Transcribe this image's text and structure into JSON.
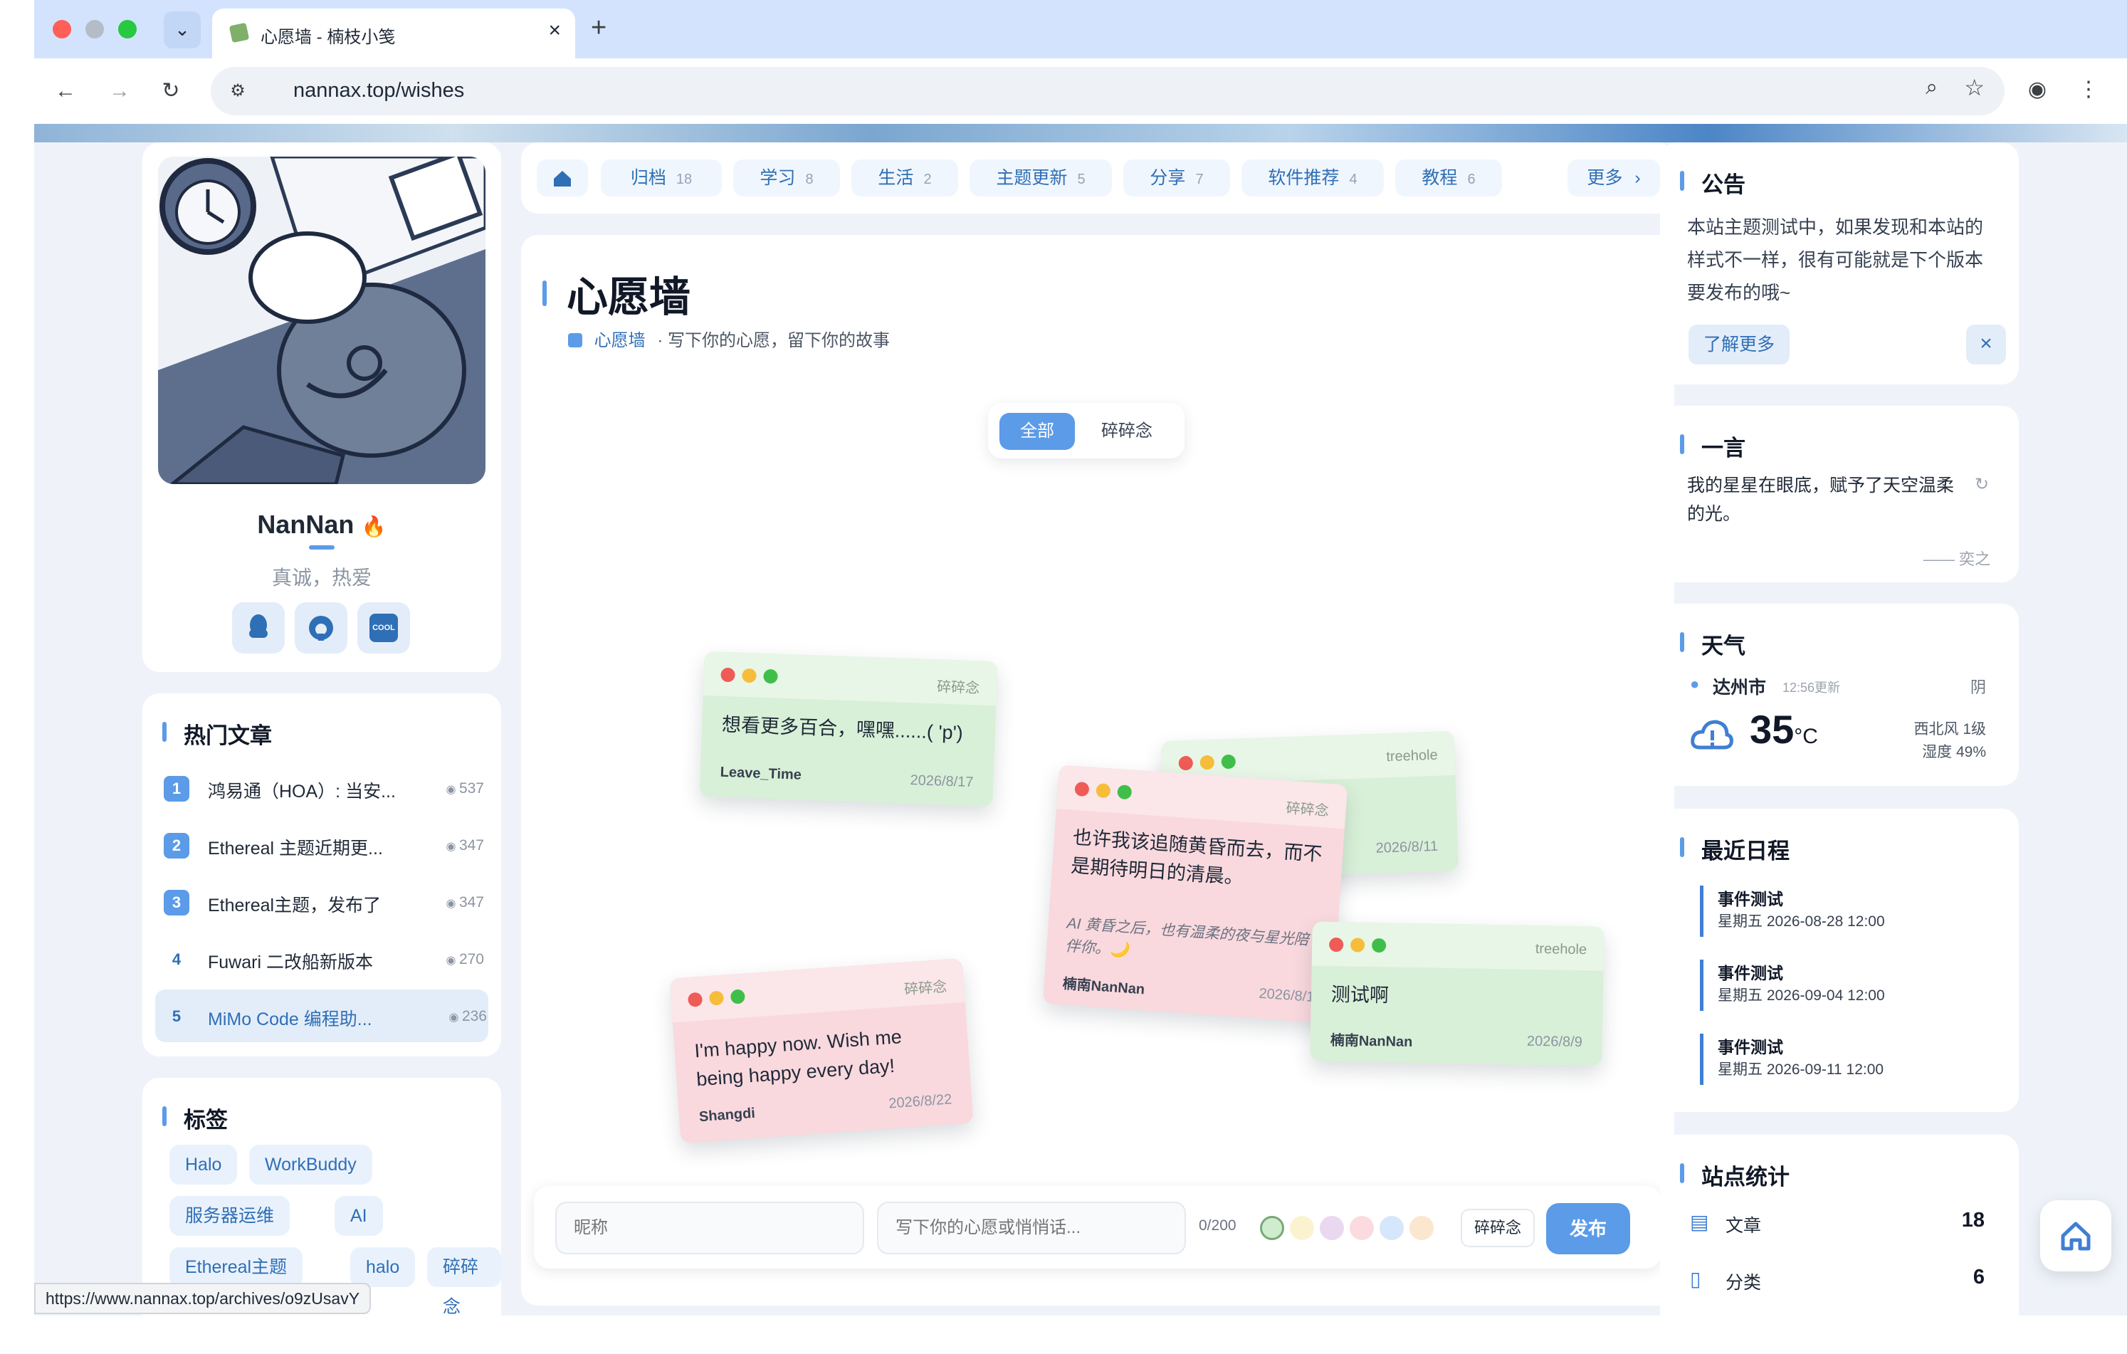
{
  "browser": {
    "tab_title": "心愿墙 - 楠枝小笺",
    "url": "nannax.top/wishes",
    "status_url": "https://www.nannax.top/archives/o9zUsavY"
  },
  "nav": {
    "home_icon": "home-icon",
    "items": [
      {
        "label": "归档",
        "count": "18"
      },
      {
        "label": "学习",
        "count": "8"
      },
      {
        "label": "生活",
        "count": "2"
      },
      {
        "label": "主题更新",
        "count": "5"
      },
      {
        "label": "分享",
        "count": "7"
      },
      {
        "label": "软件推荐",
        "count": "4"
      },
      {
        "label": "教程",
        "count": "6"
      }
    ],
    "more": "更多"
  },
  "profile": {
    "name": "NanNan",
    "motto": "真诚，热爱",
    "social": [
      "qq-icon",
      "github-icon",
      "coolapk-icon"
    ],
    "cool_text": "COOL"
  },
  "hot": {
    "title": "热门文章",
    "items": [
      {
        "num": "1",
        "title": "鸿易通（HOA）: 当安...",
        "views": "537"
      },
      {
        "num": "2",
        "title": "Ethereal 主题近期更...",
        "views": "347"
      },
      {
        "num": "3",
        "title": "Ethereal主题，发布了",
        "views": "347"
      },
      {
        "num": "4",
        "title": "Fuwari 二改船新版本",
        "views": "270"
      },
      {
        "num": "5",
        "title": "MiMo Code 编程助...",
        "views": "236"
      }
    ]
  },
  "tags": {
    "title": "标签",
    "items": [
      "Halo",
      "WorkBuddy",
      "服务器运维",
      "AI",
      "Ethereal主题",
      "halo",
      "碎碎念"
    ]
  },
  "main": {
    "title": "心愿墙",
    "crumb": "心愿墙",
    "subtitle": "· 写下你的心愿，留下你的故事",
    "filters": [
      "全部",
      "碎碎念"
    ],
    "wishes": [
      {
        "tag": "碎碎念",
        "text": "想看更多百合，嘿嘿......( 'p')",
        "author": "Leave_Time",
        "date": "2026/8/17"
      },
      {
        "tag": "treehole",
        "text": "",
        "author": "",
        "date": "2026/8/11"
      },
      {
        "tag": "碎碎念",
        "text": "也许我该追随黄昏而去，而不是期待明日的清晨。",
        "ai": "AI 黄昏之后，也有温柔的夜与星光陪伴你。🌙",
        "author": "楠南NanNan",
        "date": "2026/8/1"
      },
      {
        "tag": "treehole",
        "text": "测试啊",
        "author": "楠南NanNan",
        "date": "2026/8/9"
      },
      {
        "tag": "碎碎念",
        "text": "I'm happy now. Wish me being happy every day!",
        "author": "Shangdi",
        "date": "2026/8/22"
      }
    ],
    "form": {
      "nick_placeholder": "昵称",
      "msg_placeholder": "写下你的心愿或悄悄话...",
      "counter": "0/200",
      "colors": [
        "#cfeccd",
        "#fbf3d0",
        "#ead7f0",
        "#fbdbe0",
        "#d6e7fb",
        "#fbe6cf"
      ],
      "type_label": "碎碎念",
      "submit": "发布"
    }
  },
  "notice": {
    "title": "公告",
    "text": "本站主题测试中，如果发现和本站的样式不一样，很有可能就是下个版本要发布的哦~",
    "more": "了解更多"
  },
  "quote": {
    "title": "一言",
    "text": "我的星星在眼底，赋予了天空温柔的光。",
    "author": "—— 奕之"
  },
  "weather": {
    "title": "天气",
    "city": "达州市",
    "updated": "12:56更新",
    "condition": "阴",
    "temp": "35",
    "unit": "°C",
    "wind": "西北风 1级",
    "humidity": "湿度 49%"
  },
  "schedule": {
    "title": "最近日程",
    "items": [
      {
        "title": "事件测试",
        "date": "星期五 2026-08-28 12:00"
      },
      {
        "title": "事件测试",
        "date": "星期五 2026-09-04 12:00"
      },
      {
        "title": "事件测试",
        "date": "星期五 2026-09-11 12:00"
      }
    ]
  },
  "stats": {
    "title": "站点统计",
    "items": [
      {
        "label": "文章",
        "value": "18"
      },
      {
        "label": "分类",
        "value": "6"
      }
    ]
  }
}
